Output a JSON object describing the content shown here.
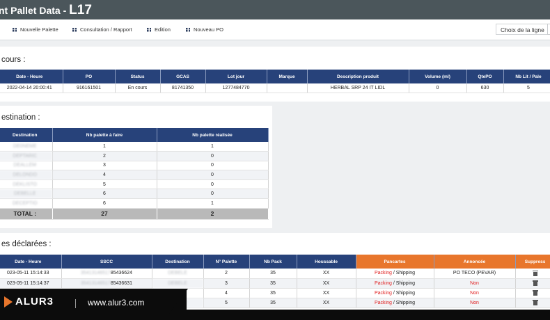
{
  "header": {
    "title_prefix": "nt Pallet Data - ",
    "title_line": "L17"
  },
  "nav": {
    "items": [
      "Nouvelle Palette",
      "Consultation / Rapport",
      "Edition",
      "Nouveau PO"
    ],
    "line_chooser_label": "Choix de la ligne"
  },
  "current": {
    "title": "cours :",
    "columns": [
      "Date - Heure",
      "PO",
      "Status",
      "GCAS",
      "Lot jour",
      "Marque",
      "Description produit",
      "Volume (ml)",
      "QtePO",
      "Nb Lit / Pale"
    ],
    "rows": [
      [
        "2022-04-14 20:00:41",
        "916161501",
        "En cours",
        "81741350",
        "1277484770",
        "",
        "HERBAL SRP 24 IT LIDL",
        "0",
        "630",
        "5"
      ]
    ]
  },
  "destination": {
    "title": "estination :",
    "columns": [
      "Destination",
      "Nb palette à faire",
      "Nb palette réalisée"
    ],
    "rows": [
      [
        "DE0NEME",
        "1",
        "1"
      ],
      [
        "DEPTARIC",
        "2",
        "0"
      ],
      [
        "DEALLEM",
        "3",
        "0"
      ],
      [
        "DELONDO",
        "4",
        "0"
      ],
      [
        "DEKLISTO",
        "5",
        "0"
      ],
      [
        "DEBELLE",
        "6",
        "0"
      ],
      [
        "DECEPTIO",
        "6",
        "1"
      ]
    ],
    "total_label": "TOTAL :",
    "total_todo": "27",
    "total_done": "2"
  },
  "declared": {
    "title": "es déclarées :",
    "columns": [
      "Date - Heure",
      "SSCC",
      "Destination",
      "N° Palette",
      "Nb Pack",
      "Houssable",
      "Pancartes",
      "Annoncée",
      "Suppress"
    ],
    "rows": [
      {
        "date": "023-05-11 15:14:33",
        "sscc_hidden": "35413146517",
        "sscc": "85436624",
        "dest": "DEBELE",
        "palette": "2",
        "pack": "35",
        "houssable": "XX",
        "pancarte_a": "Packing",
        "sep": "/",
        "pancarte_b": "Shipping",
        "annoncee": "PO TECO (PEVAR)",
        "annoncee_red": false
      },
      {
        "date": "023-05-11 15:14:37",
        "sscc_hidden": "35413146517",
        "sscc": "85436631",
        "dest": "DEBELE",
        "palette": "3",
        "pack": "35",
        "houssable": "XX",
        "pancarte_a": "Packing",
        "sep": "/",
        "pancarte_b": "Shipping",
        "annoncee": "Non",
        "annoncee_red": true
      },
      {
        "date": "",
        "sscc_hidden": "",
        "sscc": "",
        "dest": "DEBELE",
        "palette": "4",
        "pack": "35",
        "houssable": "XX",
        "pancarte_a": "Packing",
        "sep": "/",
        "pancarte_b": "Shipping",
        "annoncee": "Non",
        "annoncee_red": true
      },
      {
        "date": "",
        "sscc_hidden": "",
        "sscc": "",
        "dest": "DEBELE",
        "palette": "5",
        "pack": "35",
        "houssable": "XX",
        "pancarte_a": "Packing",
        "sep": "/",
        "pancarte_b": "Shipping",
        "annoncee": "Non",
        "annoncee_red": true
      }
    ]
  },
  "footer": {
    "brand": "ALUR3",
    "url": "www.alur3.com"
  },
  "colors": {
    "header": "#4b565b",
    "table_head": "#27427a",
    "accent": "#e8762c",
    "status_red": "#e02020"
  },
  "icons": [
    "grid-icon",
    "trash-icon",
    "alur3-logo-icon"
  ]
}
